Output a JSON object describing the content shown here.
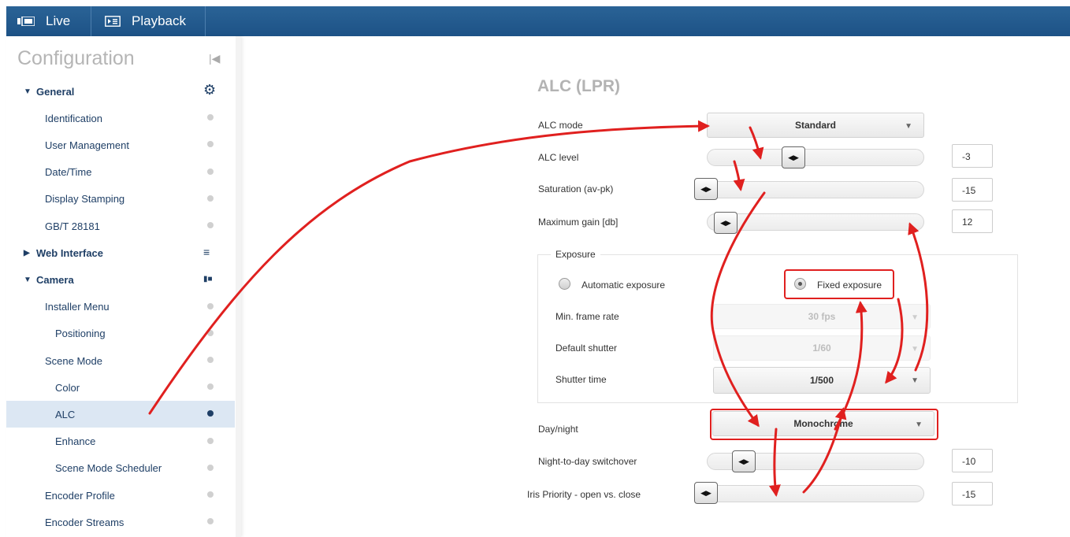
{
  "topbar": {
    "live_label": "Live",
    "playback_label": "Playback"
  },
  "sidebar": {
    "title": "Configuration",
    "items": [
      {
        "label": "General",
        "type": "section",
        "expanded": true,
        "icon": "gear-icon"
      },
      {
        "label": "Identification",
        "type": "item"
      },
      {
        "label": "User Management",
        "type": "item"
      },
      {
        "label": "Date/Time",
        "type": "item"
      },
      {
        "label": "Display Stamping",
        "type": "item"
      },
      {
        "label": "GB/T 28181",
        "type": "item"
      },
      {
        "label": "Web Interface",
        "type": "section",
        "expanded": false,
        "icon": "list-icon"
      },
      {
        "label": "Camera",
        "type": "section",
        "expanded": true,
        "icon": "camera-icon"
      },
      {
        "label": "Installer Menu",
        "type": "item"
      },
      {
        "label": "Positioning",
        "type": "subitem"
      },
      {
        "label": "Scene Mode",
        "type": "item"
      },
      {
        "label": "Color",
        "type": "subitem"
      },
      {
        "label": "ALC",
        "type": "subitem",
        "active": true
      },
      {
        "label": "Enhance",
        "type": "subitem"
      },
      {
        "label": "Scene Mode Scheduler",
        "type": "subitem"
      },
      {
        "label": "Encoder Profile",
        "type": "item"
      },
      {
        "label": "Encoder Streams",
        "type": "item"
      }
    ]
  },
  "page": {
    "title": "ALC (LPR)",
    "alc_mode": {
      "label": "ALC mode",
      "value": "Standard"
    },
    "alc_level": {
      "label": "ALC level",
      "value": "-3"
    },
    "saturation": {
      "label": "Saturation (av-pk)",
      "value": "-15"
    },
    "max_gain": {
      "label": "Maximum gain [db]",
      "value": "12"
    },
    "exposure": {
      "legend": "Exposure",
      "automatic_label": "Automatic exposure",
      "fixed_label": "Fixed exposure",
      "selected": "fixed",
      "min_frame_rate": {
        "label": "Min. frame rate",
        "value": "30 fps"
      },
      "default_shutter": {
        "label": "Default shutter",
        "value": "1/60"
      },
      "shutter_time": {
        "label": "Shutter time",
        "value": "1/500"
      }
    },
    "day_night": {
      "label": "Day/night",
      "value": "Monochrome"
    },
    "night_to_day": {
      "label": "Night-to-day switchover",
      "value": "-10"
    },
    "iris_priority": {
      "label": "Iris Priority - open vs. close",
      "value": "-15"
    }
  },
  "colors": {
    "header_blue": "#1d5286",
    "nav_text": "#1f3f66",
    "annotation_red": "#e0201f"
  }
}
